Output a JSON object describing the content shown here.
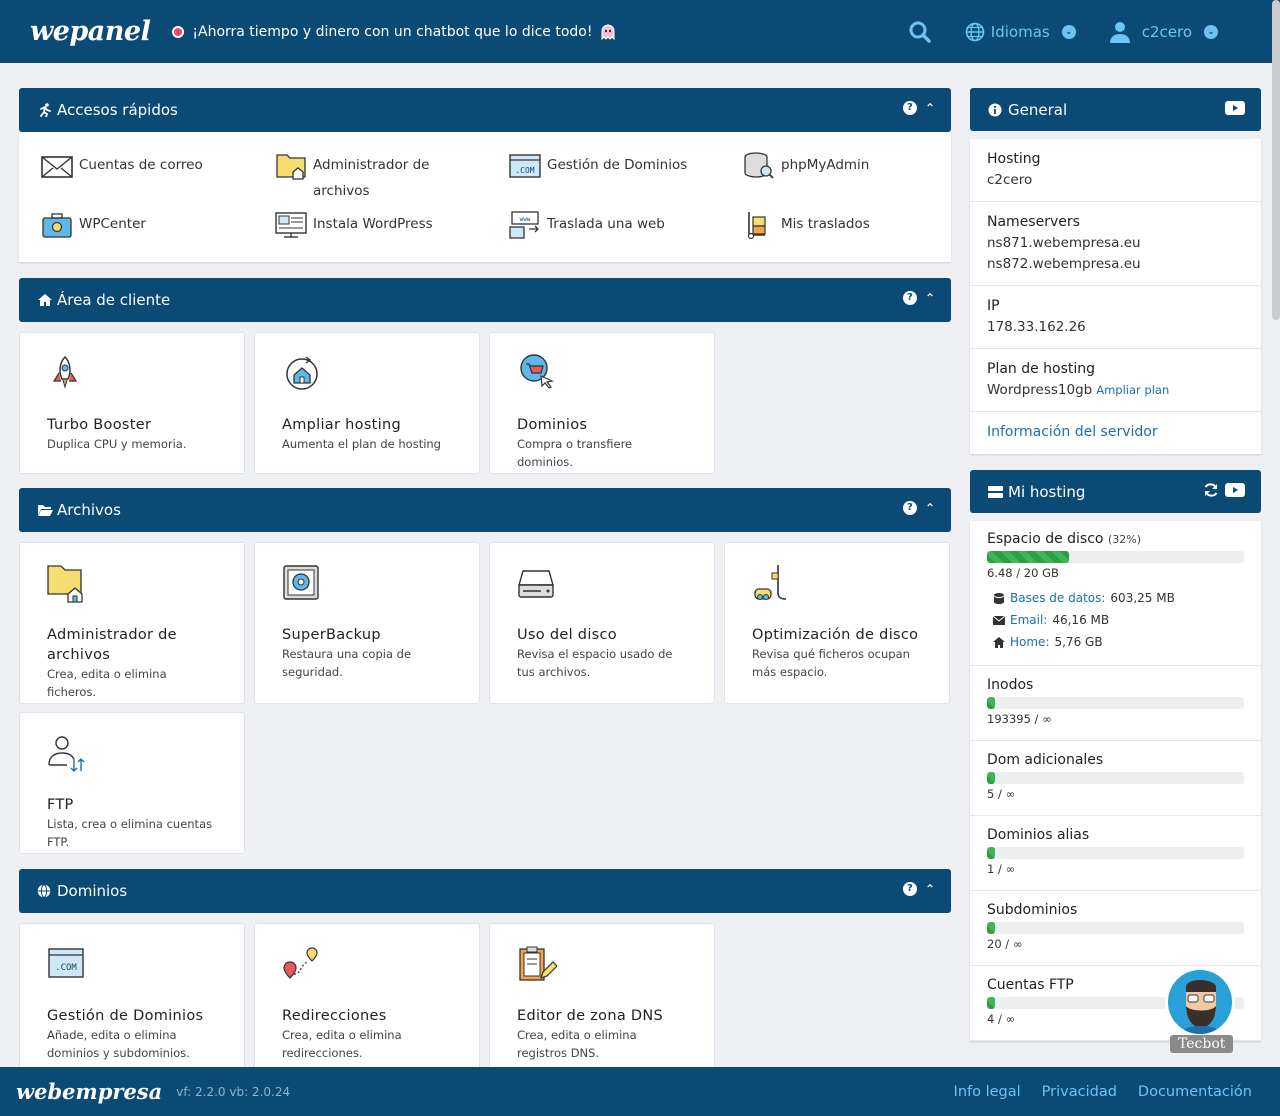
{
  "header": {
    "logo": "wepanel",
    "promo": "¡Ahorra tiempo y dinero con un chatbot que lo dice todo!",
    "language_label": "Idiomas",
    "user_label": "c2cero"
  },
  "quick_access": {
    "title": "Accesos rápidos",
    "items": [
      {
        "label": "Cuentas de correo",
        "icon": "mail-icon"
      },
      {
        "label": "Administrador de archivos",
        "icon": "folder-icon"
      },
      {
        "label": "Gestión de Dominios",
        "icon": "domain-com-icon"
      },
      {
        "label": "phpMyAdmin",
        "icon": "database-icon"
      },
      {
        "label": "WPCenter",
        "icon": "briefcase-icon"
      },
      {
        "label": "Instala WordPress",
        "icon": "monitor-icon"
      },
      {
        "label": "Traslada una web",
        "icon": "transfer-icon"
      },
      {
        "label": "Mis traslados",
        "icon": "dolly-icon"
      }
    ]
  },
  "client_area": {
    "title": "Área de cliente",
    "cards": [
      {
        "title": "Turbo Booster",
        "desc": "Duplica CPU y memoria."
      },
      {
        "title": "Ampliar hosting",
        "desc": "Aumenta el plan de hosting"
      },
      {
        "title": "Dominios",
        "desc": "Compra o transfiere dominios."
      }
    ]
  },
  "files": {
    "title": "Archivos",
    "cards": [
      {
        "title": "Administrador de archivos",
        "desc": "Crea, edita o elimina ficheros."
      },
      {
        "title": "SuperBackup",
        "desc": "Restaura una copia de seguridad."
      },
      {
        "title": "Uso del disco",
        "desc": "Revisa el espacio usado de tus archivos."
      },
      {
        "title": "Optimización de disco",
        "desc": "Revisa qué ficheros ocupan más espacio."
      },
      {
        "title": "FTP",
        "desc": "Lista, crea o elimina cuentas FTP."
      }
    ]
  },
  "domains": {
    "title": "Dominios",
    "cards": [
      {
        "title": "Gestión de Dominios",
        "desc": "Añade, edita o elimina dominios y subdominios."
      },
      {
        "title": "Redirecciones",
        "desc": "Crea, edita o elimina redirecciones."
      },
      {
        "title": "Editor de zona DNS",
        "desc": "Crea, edita o elimina registros DNS."
      }
    ]
  },
  "general": {
    "title": "General",
    "hosting_label": "Hosting",
    "hosting_value": "c2cero",
    "ns_label": "Nameservers",
    "ns1": "ns871.webempresa.eu",
    "ns2": "ns872.webempresa.eu",
    "ip_label": "IP",
    "ip_value": "178.33.162.26",
    "plan_label": "Plan de hosting",
    "plan_value": "Wordpress10gb",
    "plan_link": "Ampliar plan",
    "server_info": "Información del servidor"
  },
  "my_hosting": {
    "title": "Mi hosting",
    "disk": {
      "label": "Espacio de disco",
      "pct_label": "(32%)",
      "percent": 32,
      "value": "6.48 / 20 GB"
    },
    "breakdown": [
      {
        "key": "Bases de datos:",
        "value": "603,25 MB",
        "icon": "database-icon"
      },
      {
        "key": "Email:",
        "value": "46,16 MB",
        "icon": "envelope-icon"
      },
      {
        "key": "Home:",
        "value": "5,76 GB",
        "icon": "home-icon"
      }
    ],
    "meters": [
      {
        "label": "Inodos",
        "value": "193395 / ∞",
        "percent": 3
      },
      {
        "label": "Dom adicionales",
        "value": "5 / ∞",
        "percent": 3
      },
      {
        "label": "Dominios alias",
        "value": "1 / ∞",
        "percent": 3
      },
      {
        "label": "Subdominios",
        "value": "20 / ∞",
        "percent": 3
      },
      {
        "label": "Cuentas FTP",
        "value": "4 / ∞",
        "percent": 3
      }
    ]
  },
  "chatbot": {
    "label": "Tecbot"
  },
  "footer": {
    "logo": "webempresa",
    "version": "vf: 2.2.0  vb: 2.0.24",
    "links": [
      "Info legal",
      "Privacidad",
      "Documentación"
    ]
  },
  "colors": {
    "primary": "#0b4a75",
    "accent": "#6fc3f2",
    "progress": "#3fb556",
    "link": "#1e6fae"
  }
}
